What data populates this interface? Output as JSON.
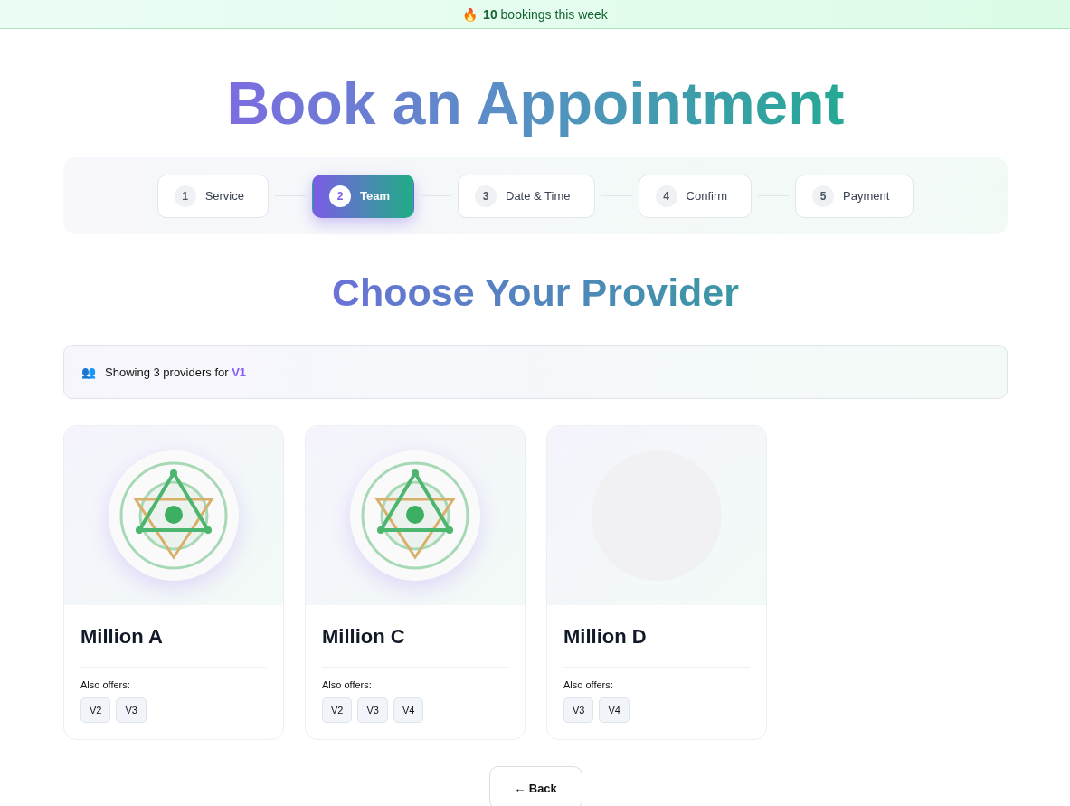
{
  "banner": {
    "icon": "🔥",
    "text": "**10** bookings this week"
  },
  "title": "Book an Appointment",
  "steps": [
    {
      "number": "1",
      "label": "Service",
      "selected": false
    },
    {
      "number": "2",
      "label": "Team",
      "selected": true
    },
    {
      "number": "3",
      "label": "Date & Time",
      "selected": false
    },
    {
      "number": "4",
      "label": "Confirm",
      "selected": false
    },
    {
      "number": "5",
      "label": "Payment",
      "selected": false
    }
  ],
  "heading": "Choose Your Provider",
  "info": {
    "icon": "👥",
    "text": "Showing 3 providers for **V1**"
  },
  "providers": [
    {
      "name": "Million A",
      "kind": "emblem",
      "offers_label": "Also offers:",
      "offers": [
        "V2",
        "V3"
      ]
    },
    {
      "name": "Million C",
      "kind": "emblem",
      "offers_label": "Also offers:",
      "offers": [
        "V2",
        "V3",
        "V4"
      ]
    },
    {
      "name": "Million D",
      "kind": "blank",
      "offers_label": "Also offers:",
      "offers": [
        "V3",
        "V4"
      ]
    }
  ],
  "back_button": "← Back"
}
